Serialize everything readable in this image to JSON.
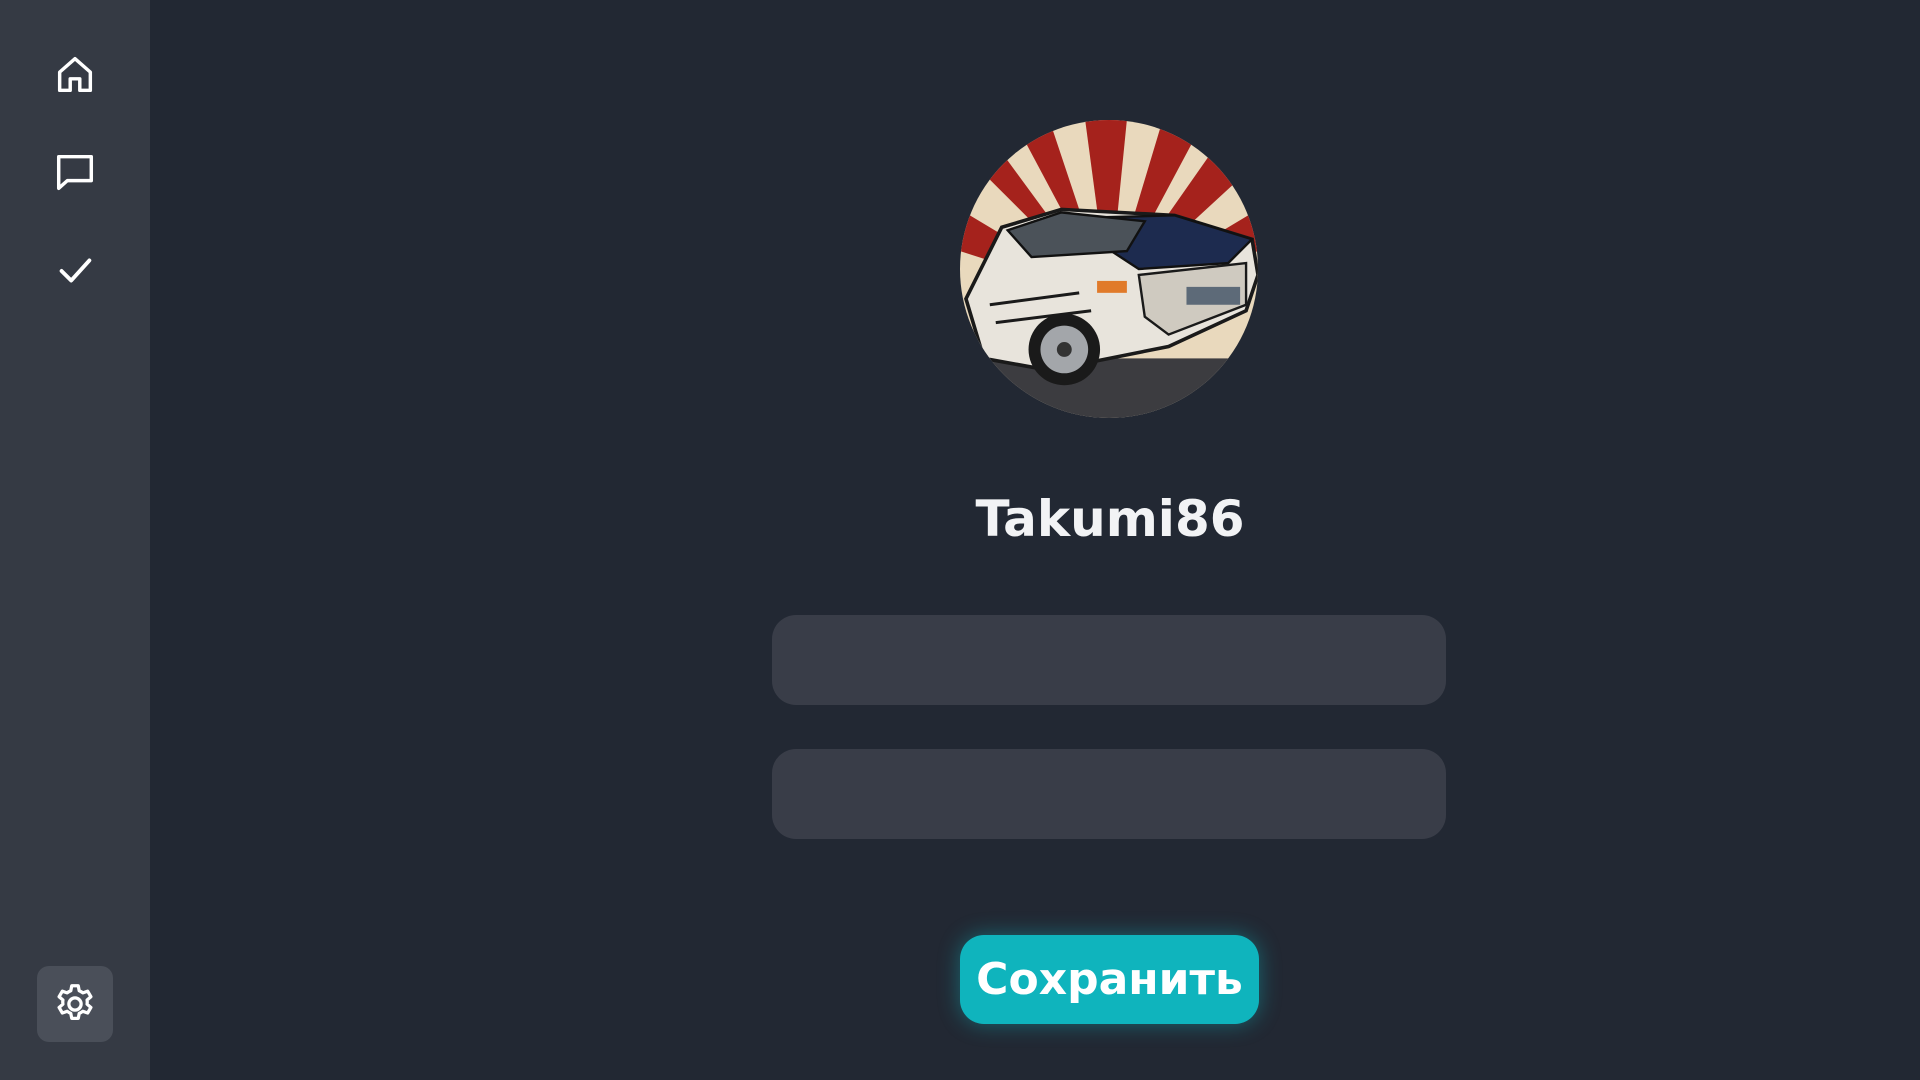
{
  "sidebar": {
    "items": [
      {
        "icon": "home-icon",
        "name": "home"
      },
      {
        "icon": "chat-icon",
        "name": "messages"
      },
      {
        "icon": "check-icon",
        "name": "tasks"
      }
    ],
    "settings": {
      "icon": "gear-icon",
      "active": true
    }
  },
  "profile": {
    "avatar": "car-illustration",
    "username": "Takumi86"
  },
  "form": {
    "field1": {
      "value": "",
      "placeholder": ""
    },
    "field2": {
      "value": "",
      "placeholder": ""
    },
    "save_label": "Сохранить"
  },
  "colors": {
    "background": "#222833",
    "sidebar": "#353a44",
    "input": "#393d48",
    "accent": "#0fb4bd"
  }
}
